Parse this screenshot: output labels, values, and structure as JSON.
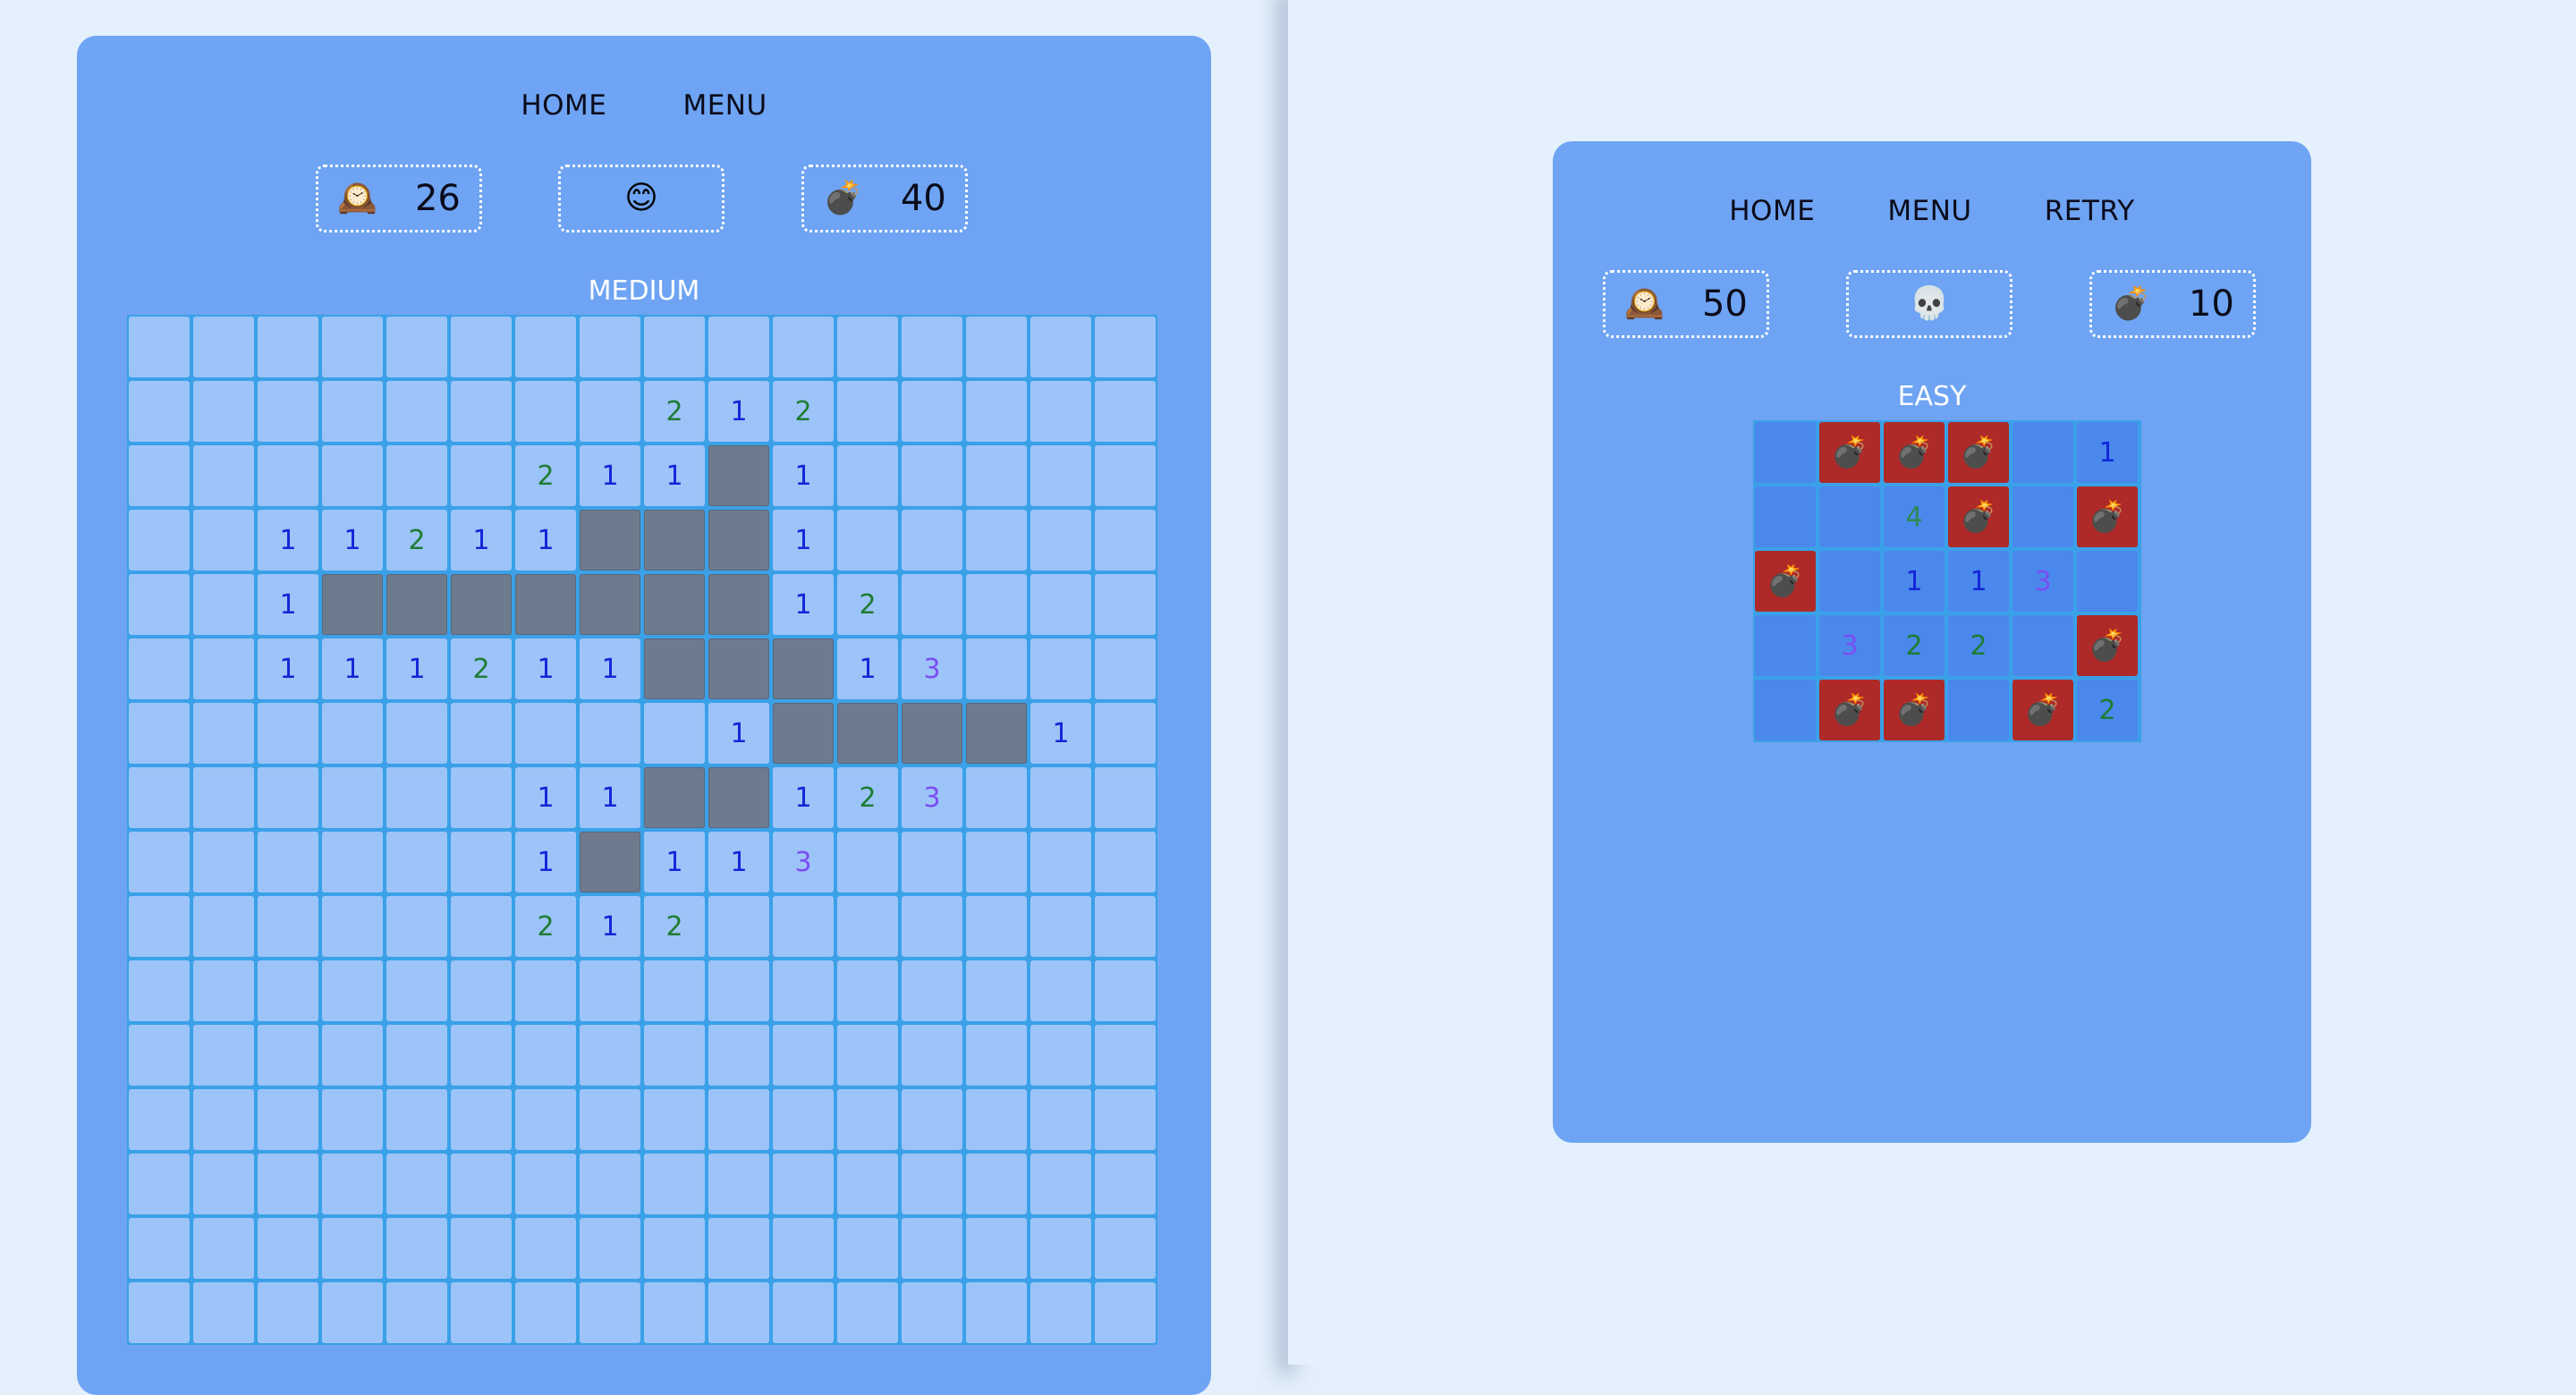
{
  "medium_game": {
    "nav": [
      "HOME",
      "MENU"
    ],
    "timer_icon": "mantel-clock",
    "timer_value": "26",
    "face_icon": "smiling-face",
    "mines_icon": "bomb",
    "mines_value": "40",
    "level": "MEDIUM",
    "board": [
      "................",
      "........212.....",
      "......211#1.....",
      "..11211###1.....",
      "..1#######12....",
      "..111211###13...",
      ".........1####1.",
      "......11##123...",
      "......1#113.....",
      "......212.......",
      "................",
      "................",
      "................",
      "................",
      "................",
      "................"
    ]
  },
  "easy_game": {
    "nav": [
      "HOME",
      "MENU",
      "RETRY"
    ],
    "timer_icon": "mantel-clock",
    "timer_value": "50",
    "face_icon": "skull",
    "mines_icon": "bomb",
    "mines_value": "10",
    "level": "EASY",
    "board": [
      ".***.1",
      "..4*.*",
      "*.113.",
      ".322.*",
      ".**.*2"
    ]
  },
  "colors": {
    "number_1": "#1126d8",
    "number_2": "#1f7c34",
    "number_3": "#7b4df2",
    "number_4": "#2b8a54",
    "panel": "#6ea4f3",
    "bomb_cell": "#ad2a28"
  }
}
